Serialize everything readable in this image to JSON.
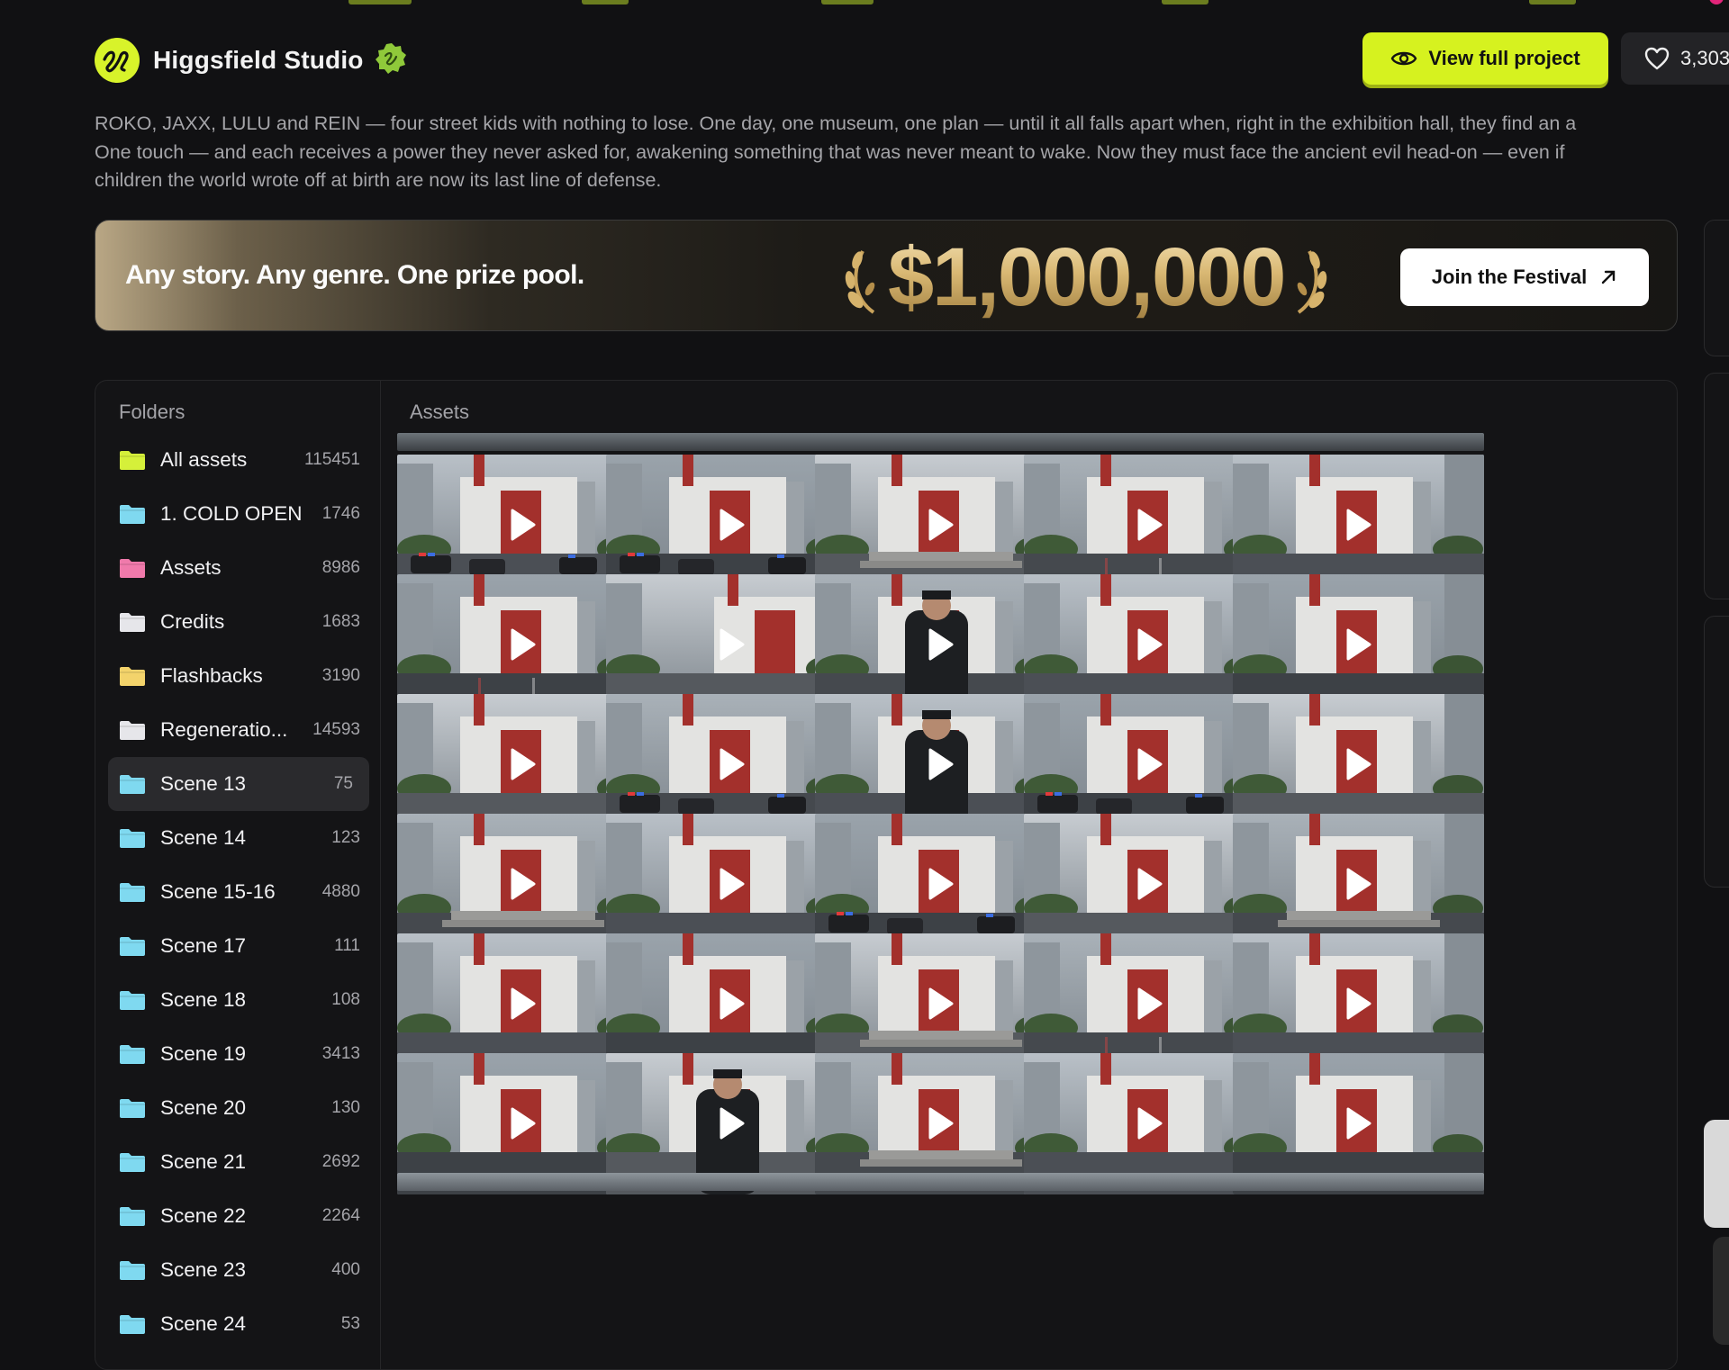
{
  "header": {
    "studio_name": "Higgsfield Studio",
    "view_button_label": "View full project",
    "like_count": "3,303"
  },
  "description": {
    "lines": [
      "ROKO, JAXX, LULU and REIN — four street kids with nothing to lose. One day, one museum, one plan — until it all falls apart when, right in the exhibition hall, they find an a",
      "One touch — and each receives a power they never asked for, awakening something that was never meant to wake. Now they must face the ancient evil head-on — even if",
      "children the world wrote off at birth are now its last line of defense."
    ]
  },
  "banner": {
    "tagline": "Any story. Any genre. One prize pool.",
    "prize": "$1,000,000",
    "join_label": "Join the Festival"
  },
  "folders": {
    "title": "Folders",
    "items": [
      {
        "label": "All assets",
        "count": "115451",
        "color": "#d5f03a"
      },
      {
        "label": "1. COLD OPEN",
        "count": "1746",
        "color": "#7fd9f0"
      },
      {
        "label": "Assets",
        "count": "8986",
        "color": "#f07aab"
      },
      {
        "label": "Credits",
        "count": "1683",
        "color": "#e6e6ea"
      },
      {
        "label": "Flashbacks",
        "count": "3190",
        "color": "#f3d36b"
      },
      {
        "label": "Regeneratio...",
        "count": "14593",
        "color": "#e6e6ea"
      },
      {
        "label": "Scene 13",
        "count": "75",
        "color": "#7fd9f0",
        "active": true
      },
      {
        "label": "Scene 14",
        "count": "123",
        "color": "#7fd9f0"
      },
      {
        "label": "Scene 15-16",
        "count": "4880",
        "color": "#7fd9f0"
      },
      {
        "label": "Scene 17",
        "count": "111",
        "color": "#7fd9f0"
      },
      {
        "label": "Scene 18",
        "count": "108",
        "color": "#7fd9f0"
      },
      {
        "label": "Scene 19",
        "count": "3413",
        "color": "#7fd9f0"
      },
      {
        "label": "Scene 20",
        "count": "130",
        "color": "#7fd9f0"
      },
      {
        "label": "Scene 21",
        "count": "2692",
        "color": "#7fd9f0"
      },
      {
        "label": "Scene 22",
        "count": "2264",
        "color": "#7fd9f0"
      },
      {
        "label": "Scene 23",
        "count": "400",
        "color": "#7fd9f0"
      },
      {
        "label": "Scene 24",
        "count": "53",
        "color": "#7fd9f0"
      }
    ]
  },
  "assets": {
    "title": "Assets",
    "columns": 5,
    "full_rows": 6,
    "thumb_kinds": [
      "museum-police",
      "street-cars",
      "museum-steps",
      "museum-rain",
      "street-wide",
      "plaza-wet",
      "museum-side",
      "officer-phone",
      "museum-trees",
      "street-crossing",
      "plaza-empty",
      "police-cars",
      "officer-phone",
      "police-lights",
      "street-crossing",
      "museum-front",
      "museum-sun",
      "police-cars",
      "museum-street",
      "museum-steps",
      "plaza-empty",
      "street-aerial",
      "museum-steps",
      "museum-rain",
      "street-wide",
      "plaza-crossing",
      "officer-truck",
      "museum-steps",
      "street-pole",
      "street-wide"
    ]
  }
}
